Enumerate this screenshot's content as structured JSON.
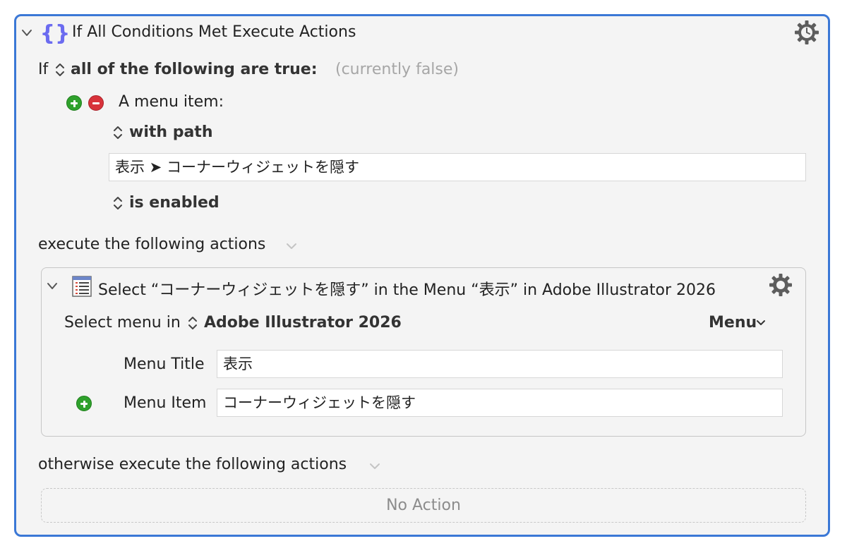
{
  "if_block": {
    "title": "If All Conditions Met Execute Actions",
    "if_label": "If",
    "condition_mode": "all of the following are true:",
    "condition_status": "(currently false)",
    "condition": {
      "label": "A menu item:",
      "path_mode": "with path",
      "path_value": "表示 ➤ コーナーウィジェットを隠す",
      "state": "is enabled"
    },
    "execute_label": "execute the following actions",
    "otherwise_label": "otherwise execute the following actions",
    "no_action": "No Action"
  },
  "action": {
    "title": "Select “コーナーウィジェットを隠す” in the Menu “表示” in Adobe Illustrator 2026",
    "select_menu_label": "Select menu in",
    "app_name": "Adobe Illustrator 2026",
    "menu_dropdown": "Menu",
    "menu_title_label": "Menu Title",
    "menu_title_value": "表示",
    "menu_item_label": "Menu Item",
    "menu_item_value": "コーナーウィジェットを隠す"
  },
  "colors": {
    "accent_border": "#3b78d6",
    "braces_icon": "#6b6bf0",
    "add_green": "#2fa12c",
    "remove_red": "#d8323a"
  },
  "icons": [
    "collapse-chevron-icon",
    "braces-icon",
    "gear-clock-icon",
    "updown-icon",
    "add-icon",
    "remove-icon",
    "menu-list-icon",
    "gear-icon",
    "dropdown-chevron-icon"
  ]
}
